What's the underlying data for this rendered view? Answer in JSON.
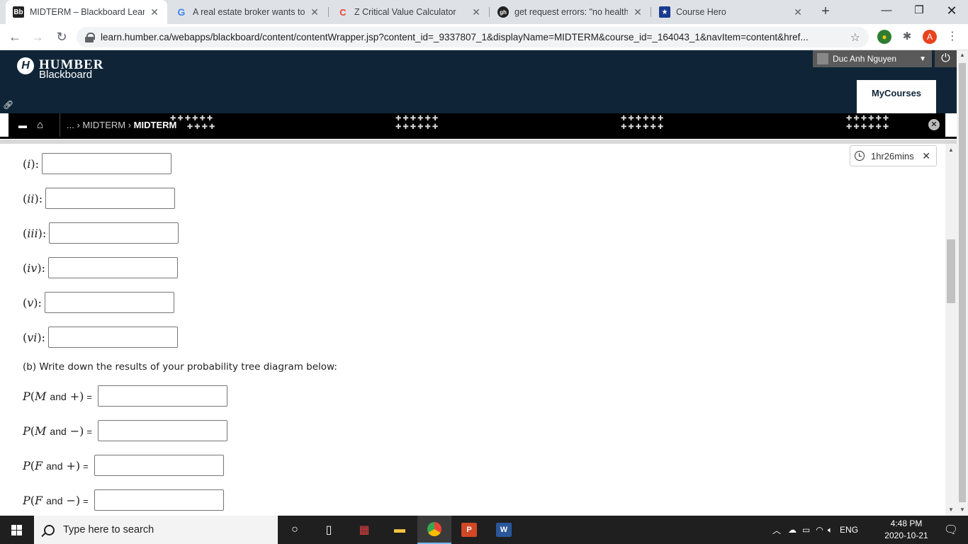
{
  "browser": {
    "tabs": [
      {
        "title": "MIDTERM – Blackboard Learn",
        "favicon": "Bb"
      },
      {
        "title": "A real estate broker wants to a",
        "favicon": "G"
      },
      {
        "title": "Z Critical Value Calculator",
        "favicon": "C"
      },
      {
        "title": "get request errors: \"no healthy",
        "favicon": "gh"
      },
      {
        "title": "Course Hero",
        "favicon": "★"
      }
    ],
    "url": "learn.humber.ca/webapps/blackboard/content/contentWrapper.jsp?content_id=_9337807_1&displayName=MIDTERM&course_id=_164043_1&navItem=content&href...",
    "profile_initial": "A"
  },
  "blackboard": {
    "logo_top": "HUMBER",
    "logo_bottom": "Blackboard",
    "user_name": "Duc Anh Nguyen",
    "my_courses": "MyCourses",
    "breadcrumb": {
      "ellipsis": "...",
      "parent": "MIDTERM",
      "current": "MIDTERM"
    }
  },
  "quiz": {
    "timer": "1hr26mins",
    "part_a_items": [
      {
        "roman": "i",
        "value": ""
      },
      {
        "roman": "ii",
        "value": ""
      },
      {
        "roman": "iii",
        "value": ""
      },
      {
        "roman": "iv",
        "value": ""
      },
      {
        "roman": "v",
        "value": ""
      },
      {
        "roman": "vi",
        "value": ""
      }
    ],
    "part_b_prompt": "(b) Write down the results of your probability tree diagram below:",
    "part_b_items": [
      {
        "event": "M",
        "sign": "+",
        "value": ""
      },
      {
        "event": "M",
        "sign": "−",
        "value": ""
      },
      {
        "event": "F",
        "sign": "+",
        "value": ""
      },
      {
        "event": "F",
        "sign": "−",
        "value": ""
      }
    ],
    "and_word": "and"
  },
  "taskbar": {
    "search_placeholder": "Type here to search",
    "language": "ENG",
    "time": "4:48 PM",
    "date": "2020-10-21"
  }
}
